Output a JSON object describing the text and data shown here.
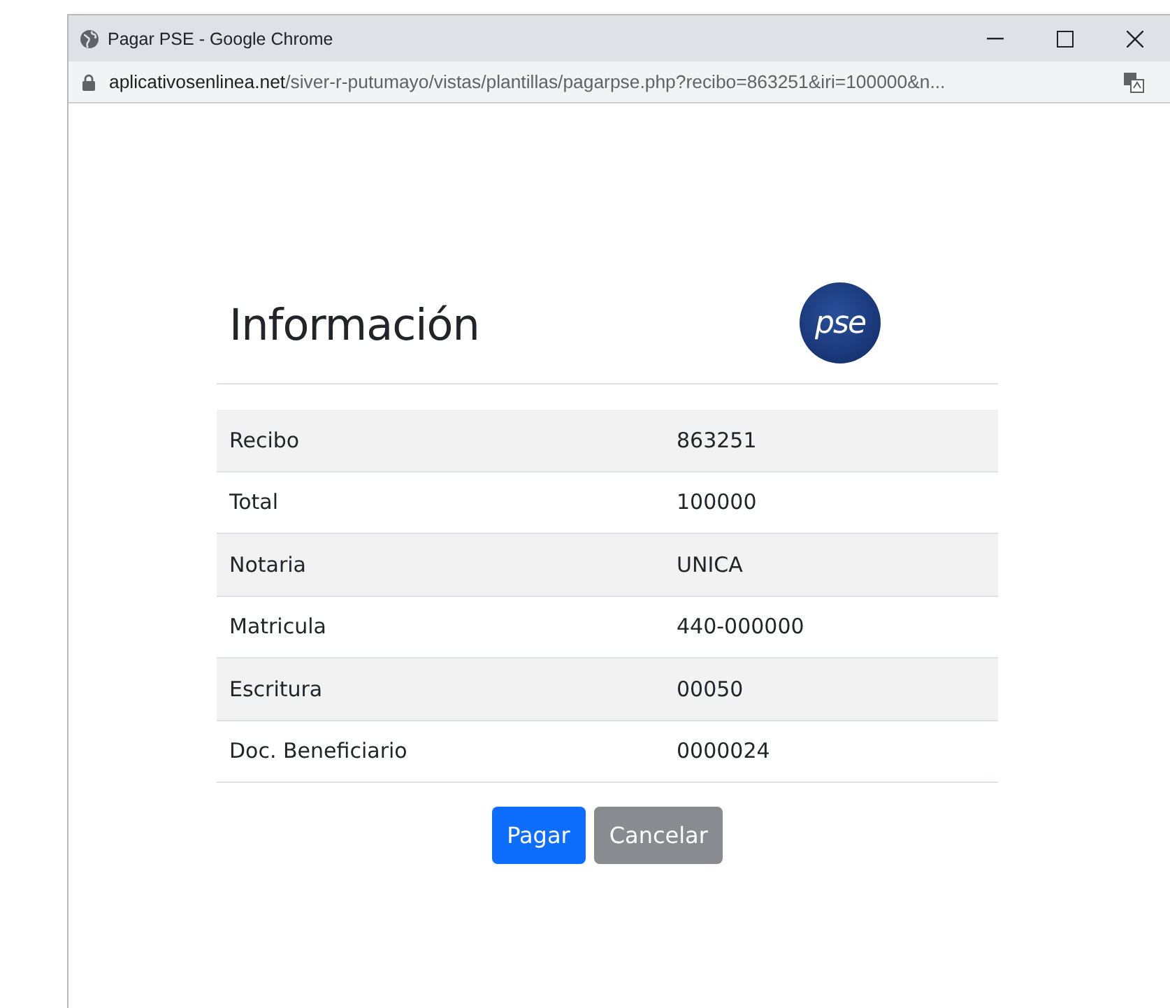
{
  "window": {
    "title": "Pagar PSE - Google Chrome",
    "url_host": "aplicativosenlinea.net",
    "url_path": "/siver-r-putumayo/vistas/plantillas/pagarpse.php?recibo=863251&iri=100000&n..."
  },
  "page": {
    "heading": "Información",
    "logo_text": "pse"
  },
  "table": {
    "rows": [
      {
        "label": "Recibo",
        "value": "863251"
      },
      {
        "label": "Total",
        "value": "100000"
      },
      {
        "label": "Notaria",
        "value": "UNICA"
      },
      {
        "label": "Matricula",
        "value": "440-000000"
      },
      {
        "label": "Escritura",
        "value": "00050"
      },
      {
        "label": "Doc. Beneficiario",
        "value": "0000024"
      }
    ]
  },
  "buttons": [
    {
      "label": "Pagar",
      "kind": "primary"
    },
    {
      "label": "Cancelar",
      "kind": "secondary"
    }
  ]
}
